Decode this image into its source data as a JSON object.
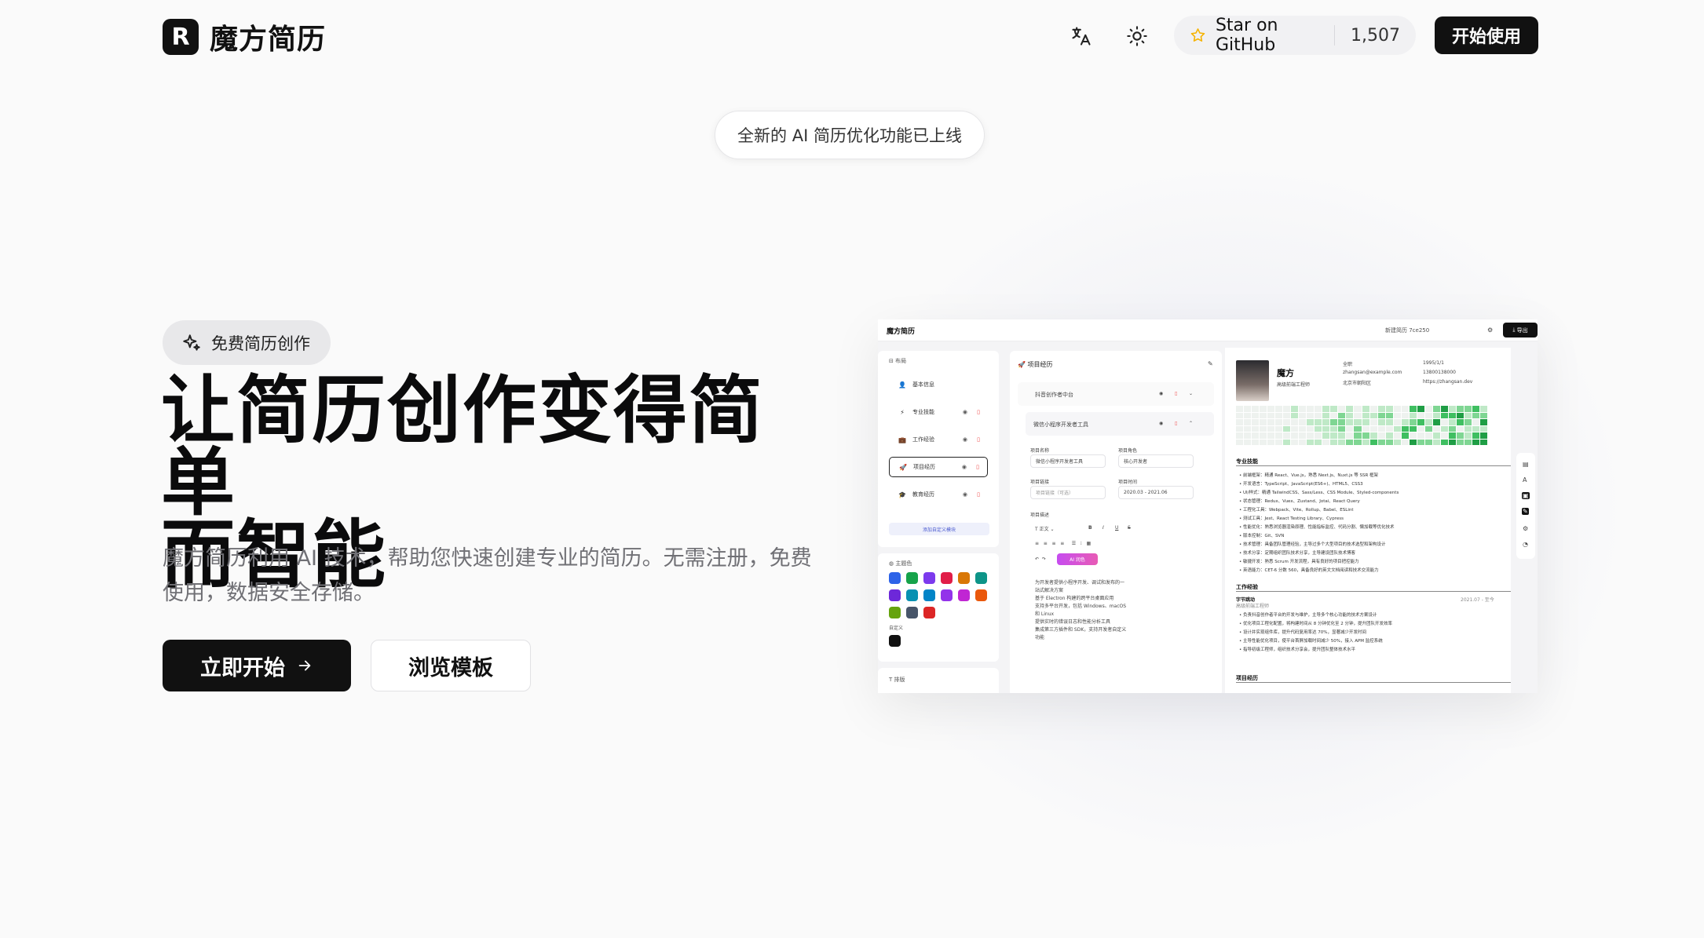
{
  "header": {
    "logo_letter": "R",
    "brand": "魔方简历",
    "github_label": "Star on GitHub",
    "github_count": "1,507",
    "start_label": "开始使用"
  },
  "announcement": "全新的 AI 简历优化功能已上线",
  "hero": {
    "badge": "免费简历创作",
    "title_line1": "让简历创作变得简单",
    "title_line2": "而智能",
    "desc_line1": "魔方简历利用 AI 技术，帮助您快速创建专业的简历。无需注册，免费",
    "desc_line2": "使用，数据安全存储。",
    "cta_primary": "立即开始",
    "cta_secondary": "浏览模板"
  },
  "preview": {
    "brand": "魔方简历",
    "filename": "新建简历 7ce250",
    "export": "导出",
    "layout_label": "布局",
    "modules": [
      {
        "icon": "person-icon",
        "glyph": "👤",
        "label": "基本信息"
      },
      {
        "icon": "bolt-icon",
        "glyph": "⚡",
        "label": "专业技能"
      },
      {
        "icon": "briefcase-icon",
        "glyph": "💼",
        "label": "工作经验"
      },
      {
        "icon": "rocket-icon",
        "glyph": "🚀",
        "label": "项目经历"
      },
      {
        "icon": "grad-cap-icon",
        "glyph": "🎓",
        "label": "教育经历"
      }
    ],
    "add_module": "添加自定义模块",
    "theme_label": "主题色",
    "custom_label": "自定义",
    "sort_label": "排版",
    "theme_colors": [
      "#2d63e8",
      "#16a34a",
      "#7c3aed",
      "#e11d48",
      "#d97706",
      "#0d9488",
      "#6d28d9",
      "#0891b2",
      "#0284c7",
      "#9333ea",
      "#c026d3",
      "#ea580c",
      "#65a30d",
      "#475569",
      "#dc2626"
    ],
    "custom_color": "#111111",
    "editor": {
      "section": "项目经历",
      "project1": "抖音创作者中台",
      "project2": "微信小程序开发者工具",
      "f_name_label": "项目名称",
      "f_name_value": "微信小程序开发者工具",
      "f_role_label": "项目角色",
      "f_role_value": "核心开发者",
      "f_link_label": "项目链接",
      "f_link_value": "项目链接（可选）",
      "f_time_label": "项目时间",
      "f_time_value": "2020.03 - 2021.06",
      "f_desc_label": "项目描述",
      "text_btn": "正文",
      "ai_btn": "AI 润色",
      "bullets": [
        "为开发者提供小程序开发、调试和发布的一",
        "站式解决方案",
        "基于 Electron 构建的跨平台桌面应用",
        "支持多平台开发，包括 Windows、macOS",
        "和 Linux",
        "提供实时的错误日志和性能分析工具",
        "集成第三方插件和 SDK，支持开发者自定义",
        "功能"
      ]
    },
    "resume": {
      "name": "魔方",
      "title": "高级前端工程师",
      "contact": [
        "全职",
        "zhangsan@example.com",
        "北京市朝阳区",
        "1995/1/1",
        "13800138000",
        "https://zhangsan.dev"
      ],
      "skills_title": "专业技能",
      "skills": [
        "前端框架：精通 React、Vue.js，熟悉 Next.js、Nuxt.js 等 SSR 框架",
        "开发语言：TypeScript、JavaScript(ES6+)、HTML5、CSS3",
        "UI/样式：精通 TailwindCSS、Sass/Less、CSS Module、Styled-components",
        "状态管理：Redux、Vuex、Zustand、Jotai、React Query",
        "工程化工具：Webpack、Vite、Rollup、Babel、ESLint",
        "测试工具：Jest、React Testing Library、Cypress",
        "性能优化：熟悉浏览器渲染原理、性能指标监控、代码分割、懒加载等优化技术",
        "版本控制：Git、SVN",
        "技术管理：具备团队管理经验，主导过多个大型项目的技术选型和架构设计",
        "技术分享：定期组织团队技术分享，主导建设团队技术博客",
        "敏捷开发：熟悉 Scrum 开发流程，具有良好的项目把控能力",
        "英语能力：CET-6 分数 560，具备良好的英文文档阅读和技术交流能力"
      ],
      "work_title": "工作经验",
      "company": "字节跳动",
      "company_role": "高级前端工程师",
      "company_time": "2021.07 - 至今",
      "work": [
        "负责抖音创作者平台的开发与维护，主导多个核心功能的技术方案设计",
        "优化项目工程化配置，将构建时间从 8 分钟优化至 2 分钟，提升团队开发效率",
        "设计并实现组件库，提升代码复用率达 70%，显著减少开发时间",
        "主导性能优化项目，使平台首屏加载时间减少 50%，接入 APM 监控系统",
        "指导初级工程师，组织技术分享会，提升团队整体技术水平"
      ],
      "project_title": "项目经历"
    }
  },
  "colors": {
    "accent": "#111111",
    "star": "#f5b301"
  }
}
